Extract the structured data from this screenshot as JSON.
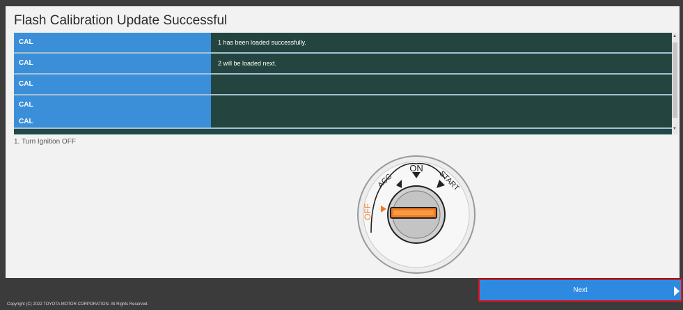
{
  "title": "Flash Calibration Update Successful",
  "table": {
    "rows": [
      {
        "label": "CAL",
        "message": "1 has been loaded successfully."
      },
      {
        "label": "CAL",
        "message": "2 will be loaded next."
      },
      {
        "label": "CAL",
        "message": ""
      },
      {
        "label": "CAL",
        "message": ""
      },
      {
        "label": "CAL",
        "message": ""
      }
    ]
  },
  "instruction": "1. Turn Ignition OFF",
  "ignition": {
    "positions": [
      "OFF",
      "ACC",
      "ON",
      "START"
    ],
    "selected": "OFF",
    "accent_color": "#f07a20"
  },
  "buttons": {
    "next_label": "Next"
  },
  "footer": {
    "copyright": "Copyright (C) 2022 TOYOTA MOTOR CORPORATION. All Rights Reserved."
  },
  "colors": {
    "header_blue": "#3a8fd8",
    "row_dark": "#24453f",
    "button_blue": "#2e8ae0",
    "highlight_red": "#e0131d"
  }
}
